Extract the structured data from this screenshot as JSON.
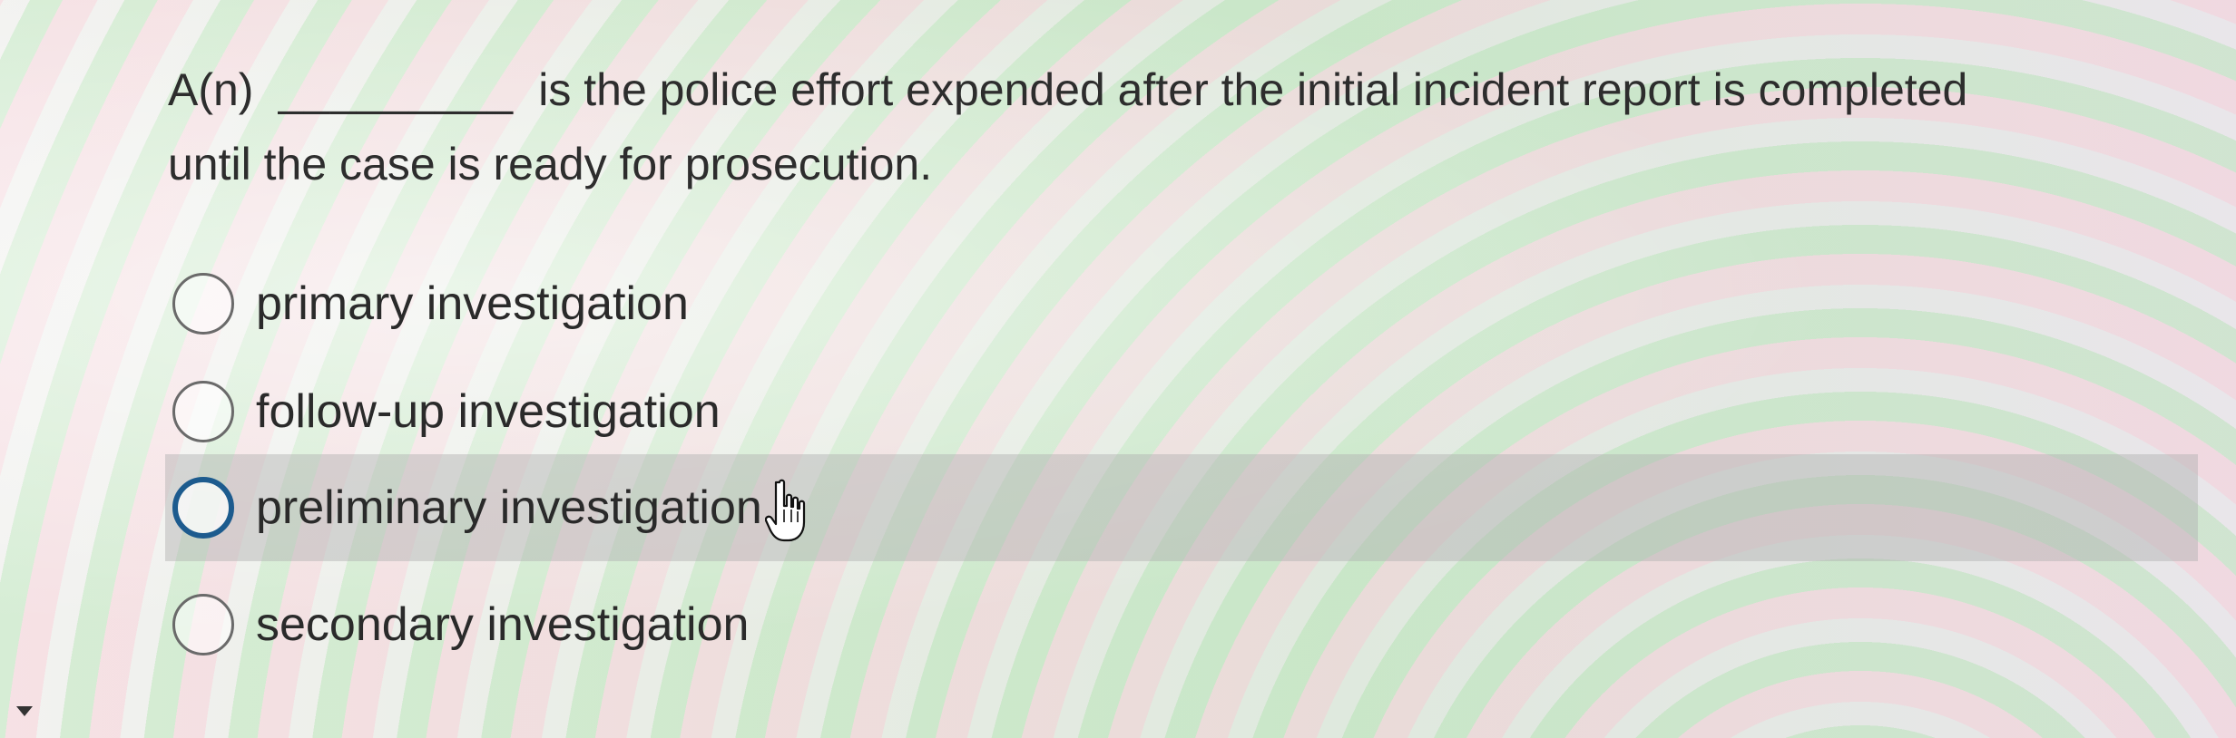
{
  "question": {
    "prefix": "A(n)",
    "blank": "_________",
    "text": "is the police effort expended after the initial incident report is completed until the case is ready for prosecution."
  },
  "options": [
    {
      "label": "primary investigation",
      "hovered": false
    },
    {
      "label": "follow-up investigation",
      "hovered": false
    },
    {
      "label": "preliminary investigation",
      "hovered": true
    },
    {
      "label": "secondary investigation",
      "hovered": false
    }
  ],
  "colors": {
    "hover_row": "#b1b1b1",
    "radio_focus_border": "#1d5b8e",
    "radio_border": "#6a6a6a",
    "text": "#2a2a2a"
  },
  "icons": {
    "cursor": "hand-pointer-icon",
    "caret": "caret-down-icon"
  }
}
